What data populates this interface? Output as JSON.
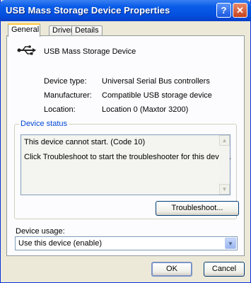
{
  "window": {
    "title": "USB Mass Storage Device Properties"
  },
  "titlebar": {
    "help_glyph": "?",
    "close_glyph": "✕"
  },
  "tabs": [
    {
      "label": "General",
      "active": true
    },
    {
      "label": "Driver",
      "active": false
    },
    {
      "label": "Details",
      "active": false
    }
  ],
  "device": {
    "icon": "usb-icon",
    "name": "USB Mass Storage Device",
    "properties": [
      {
        "label": "Device type:",
        "value": "Universal Serial Bus controllers"
      },
      {
        "label": "Manufacturer:",
        "value": "Compatible USB storage device"
      },
      {
        "label": "Location:",
        "value": "Location 0 (Maxtor 3200)"
      }
    ]
  },
  "status": {
    "group_title": "Device status",
    "lines": [
      "This device cannot start. (Code 10)",
      "Click Troubleshoot to start the troubleshooter for this device."
    ],
    "troubleshoot_label": "Troubleshoot..."
  },
  "usage": {
    "label": "Device usage:",
    "selected": "Use this device (enable)"
  },
  "footer": {
    "ok_label": "OK",
    "cancel_label": "Cancel"
  },
  "colors": {
    "titlebar": "#0A5DE8",
    "dialog_bg": "#ECE9D8",
    "group_title": "#0046D5",
    "active_tab_highlight": "#FFC73C"
  }
}
